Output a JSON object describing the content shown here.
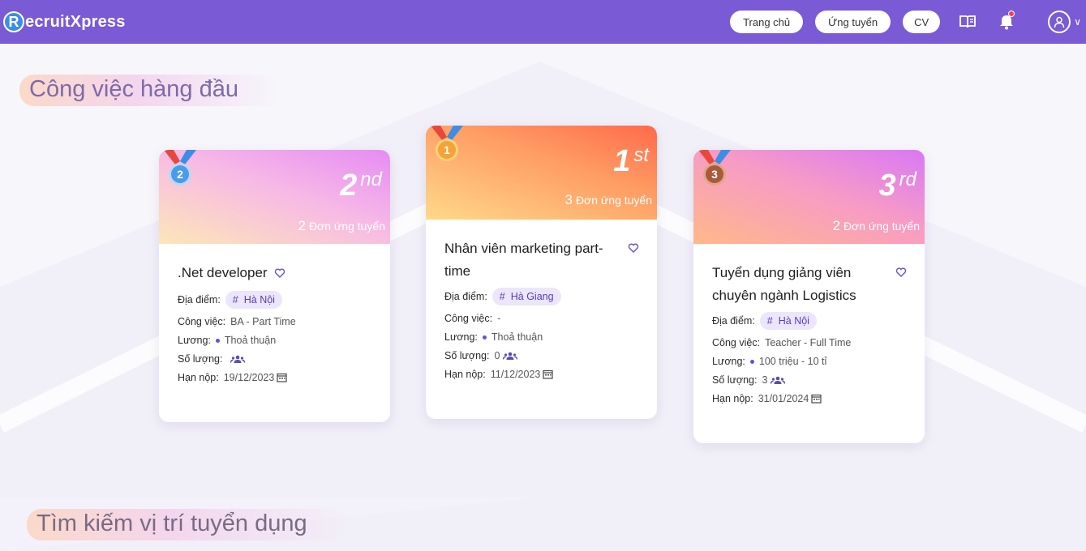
{
  "brand": {
    "logo_letter": "R",
    "name": "ecruitXpress"
  },
  "nav": {
    "home_label": "Trang chủ",
    "apply_label": "Ứng tuyển",
    "cv_label": "CV",
    "chevron": "∨"
  },
  "sections": {
    "top_jobs_title": "Công việc hàng đầu",
    "search_title": "Tìm kiếm vị trí tuyển dụng"
  },
  "labels": {
    "location": "Địa điểm:",
    "job": "Công việc:",
    "salary": "Lương:",
    "quantity": "Số lượng:",
    "deadline": "Hạn nộp:",
    "applications": "Đơn ứng tuyển"
  },
  "cards": [
    {
      "rank": "2",
      "suffix": "nd",
      "medal": "2",
      "applications": "2",
      "title": ".Net developer",
      "location": "Hà Nội",
      "job": "BA - Part Time",
      "salary": "Thoả thuận",
      "quantity": "",
      "deadline": "19/12/2023"
    },
    {
      "rank": "1",
      "suffix": "st",
      "medal": "1",
      "applications": "3",
      "title": "Nhân viên marketing part-time",
      "location": "Hà Giang",
      "job": "-",
      "salary": "Thoả thuận",
      "quantity": "0",
      "deadline": "11/12/2023"
    },
    {
      "rank": "3",
      "suffix": "rd",
      "medal": "3",
      "applications": "2",
      "title": "Tuyển dụng giảng viên chuyên ngành Logistics",
      "location": "Hà Nội",
      "job": "Teacher - Full Time",
      "salary": "100 triệu - 10 tỉ",
      "quantity": "3",
      "deadline": "31/01/2024"
    }
  ],
  "colors": {
    "navbar": "#7b5ad6",
    "accent": "#5a3bbd",
    "tag_bg": "#ebe6fb"
  },
  "icons": [
    "book-icon",
    "bell-icon",
    "user-icon",
    "heart-icon",
    "people-icon",
    "calendar-icon",
    "medal-icon"
  ]
}
